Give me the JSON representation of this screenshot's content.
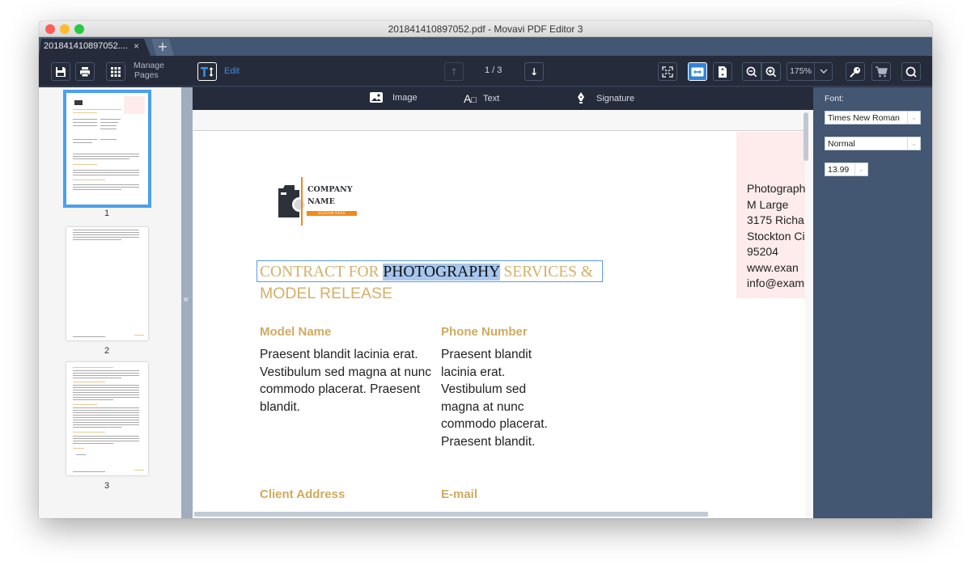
{
  "window": {
    "title": "201841410897052.pdf - Movavi PDF Editor 3"
  },
  "tabs": {
    "active_label": "201841410897052....",
    "close_glyph": "×",
    "new_tab_glyph": "+"
  },
  "toolbar": {
    "manage_pages_line1": "Manage",
    "manage_pages_line2": "Pages",
    "edit_label": "Edit",
    "page_indicator": "1 / 3",
    "zoom_value": "175%",
    "zoom_caret": "⌄"
  },
  "edit_tools": {
    "image_label": "Image",
    "text_label": "Text",
    "signature_label": "Signature"
  },
  "sidebar": {
    "collapse_glyph": "«",
    "thumbnails": [
      {
        "page": "1",
        "selected": true
      },
      {
        "page": "2",
        "selected": false
      },
      {
        "page": "3",
        "selected": false
      }
    ]
  },
  "document": {
    "logo": {
      "line1": "COMPANY",
      "line2": "NAME",
      "slogan": "SLOGAN HERE"
    },
    "title_before": "CONTRACT FOR ",
    "title_selected": "PHOTOGRAPHY",
    "title_after": " SERVICES &",
    "title_line2": "MODEL RELEASE",
    "address_lines": [
      "Photograph",
      "M Large",
      "3175 Richa",
      "Stockton Ci",
      "95204",
      "www.exan",
      "info@exam"
    ],
    "fields": [
      {
        "heading": "Model Name",
        "body": "Praesent blandit lacinia erat. Vestibulum sed magna at nunc commodo placerat. Praesent blandit."
      },
      {
        "heading": "Phone Number",
        "body": "Praesent blandit lacinia erat. Vestibulum sed magna at nunc commodo placerat. Praesent blandit."
      },
      {
        "heading": "Client Address",
        "body": ""
      },
      {
        "heading": "E-mail",
        "body": ""
      }
    ]
  },
  "font_panel": {
    "label": "Font:",
    "family": "Times New Roman",
    "style": "Normal",
    "size": "13.99",
    "caret": "⌄"
  },
  "colors": {
    "accent": "#2f84d8",
    "heading_gold": "#d4b06a",
    "toolbar_bg": "#252b3a",
    "panel_bg": "#435672",
    "selection": "#a7c7ee"
  }
}
